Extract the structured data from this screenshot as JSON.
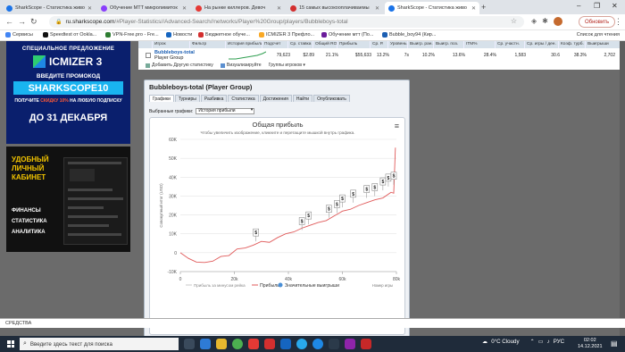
{
  "browser": {
    "tabs": [
      {
        "title": "SharkScope - Статистика живо",
        "color": "#1a73e8",
        "active": false
      },
      {
        "title": "Обучение MTT микролимиток",
        "color": "#8a3ffc",
        "active": false
      },
      {
        "title": "На рынке киллеров. Девоч",
        "color": "#e53935",
        "active": false
      },
      {
        "title": "15 самых высокооплачиваемы",
        "color": "#d32f2f",
        "active": false
      },
      {
        "title": "SharkScope - Статистика живо",
        "color": "#1a73e8",
        "active": true
      }
    ],
    "new_tab": "+",
    "win_controls": [
      "–",
      "❐",
      "✕"
    ],
    "url_domain": "ru.sharkscope.com",
    "url_path": "/#Player-Statistics//Advanced-Search//networks/Player%20Group/players/Bubbleboys-total",
    "update_label": "Обновить",
    "bookmarks": [
      "Сервисы",
      "Speedtest от Ookla...",
      "VPN-Free.pro - Fre...",
      "Новости",
      "Бюджетное обуче...",
      "ICMIZER 3 Префло...",
      "Обучение мтт (По...",
      "Bubble_boy94 (Кир..."
    ],
    "bookmarks_right": "Список для чтения"
  },
  "ads": {
    "ad1": {
      "special": "СПЕЦИАЛЬНОЕ ПРЕДЛОЖЕНИЕ",
      "logo": "ICMIZER 3",
      "promo": "ВВЕДИТЕ ПРОМОКОД",
      "code": "SHARKSCOPE10",
      "discount_pre": "ПОЛУЧИТЕ ",
      "discount_red": "СКИДКУ 10%",
      "discount_post": " НА ЛЮБУЮ ПОДПИСКУ",
      "deadline": "ДО 31 ДЕКАБРЯ"
    },
    "ad2": {
      "head": [
        "УДОБНЫЙ",
        "ЛИЧНЫЙ",
        "КАБИНЕТ"
      ],
      "items": [
        "ФИНАНСЫ",
        "СТАТИСТИКА",
        "АНАЛИТИКА"
      ]
    }
  },
  "results": {
    "headers": [
      "",
      "Игрок",
      "Фильтр",
      "История прибыли",
      "Подсчет",
      "Ср. ставка",
      "Общий ROI",
      "Прибыль",
      "Ср. Р.",
      "Уровень",
      "Выигр. ран.",
      "Выигр. поз.",
      "ITM%",
      "Ср. участн.",
      "Ср. игры / ден.",
      "Коэф. турб.",
      "Выигрыши"
    ],
    "player_name": "Bubbleboys-total",
    "player_group": "Player Group",
    "cells": [
      "79,623",
      "$2.89",
      "21.1%",
      "$55,633",
      "13.2%",
      "7s",
      "10.2%",
      "13.6%",
      "28.4%",
      "1,583",
      "30.6",
      "38.3%",
      "2,702"
    ],
    "tools": [
      "Добавить Другую статистику",
      "Визуализируйте",
      "Группы игроков ▾"
    ]
  },
  "panel": {
    "title": "Bubbleboys-total (Player Group)",
    "tabs": [
      "Графики",
      "Турниры",
      "Разбивка",
      "Статистика",
      "Достижения",
      "Найти",
      "Опубликовать"
    ],
    "graph_select_label": "Выбранные графики:",
    "graph_select_value": "История прибыли",
    "menu_icon": "≡"
  },
  "chart_data": {
    "type": "line",
    "title": "Общая прибыль",
    "subtitle": "Чтобы увеличить изображение, кликните и перетащите мышкой внутрь графика.",
    "xlabel": "Номер игры",
    "ylabel": "Совокупный итог (USD)",
    "xlim": [
      0,
      80000
    ],
    "ylim": [
      -10000,
      60000
    ],
    "x_ticks": [
      "0",
      "20k",
      "40k",
      "60k",
      "80k"
    ],
    "y_ticks": [
      "-10K",
      "0",
      "10K",
      "20K",
      "30K",
      "40K",
      "50K",
      "60K"
    ],
    "series": [
      {
        "name": "Прибыль",
        "color": "#e05a5a",
        "x": [
          0,
          3000,
          6000,
          9000,
          12000,
          15000,
          18000,
          21000,
          24000,
          27000,
          30000,
          33000,
          36000,
          39000,
          42000,
          45000,
          48000,
          51000,
          54000,
          57000,
          60000,
          63000,
          66000,
          69000,
          72000,
          75000,
          78000,
          79000,
          79623
        ],
        "values": [
          0,
          -3000,
          -5000,
          -5200,
          -4500,
          -2000,
          -1500,
          2000,
          2500,
          4000,
          6000,
          5500,
          8000,
          10000,
          11000,
          13000,
          14500,
          16000,
          17000,
          19500,
          22000,
          23000,
          25000,
          26500,
          28000,
          29000,
          32000,
          31500,
          55633
        ]
      },
      {
        "name": "Прибыль за минусом рейка",
        "color": "#c8c8c8",
        "x": [],
        "values": []
      }
    ],
    "markers": {
      "name": "Значительные выигрыши",
      "label": "$",
      "color": "#4a8fd6",
      "x": [
        28000,
        45000,
        47500,
        55000,
        58000,
        60000,
        64000,
        69000,
        72000,
        75000,
        77000,
        79000
      ],
      "y": [
        6000,
        12000,
        15000,
        18500,
        21000,
        24000,
        26500,
        29000,
        30000,
        33000,
        35000,
        36000
      ]
    },
    "legend": [
      "Прибыль за минусом рейка",
      "Прибыль",
      "Значительные выигрыши"
    ],
    "grid": true,
    "legend_position": "bottom"
  },
  "bottom_strip": "СРЕДСТВА",
  "taskbar": {
    "search_placeholder": "Введите здесь текст для поиска",
    "weather": "0°C  Cloudy",
    "lang": "РУС",
    "time": "02:02",
    "date": "14.12.2021"
  }
}
